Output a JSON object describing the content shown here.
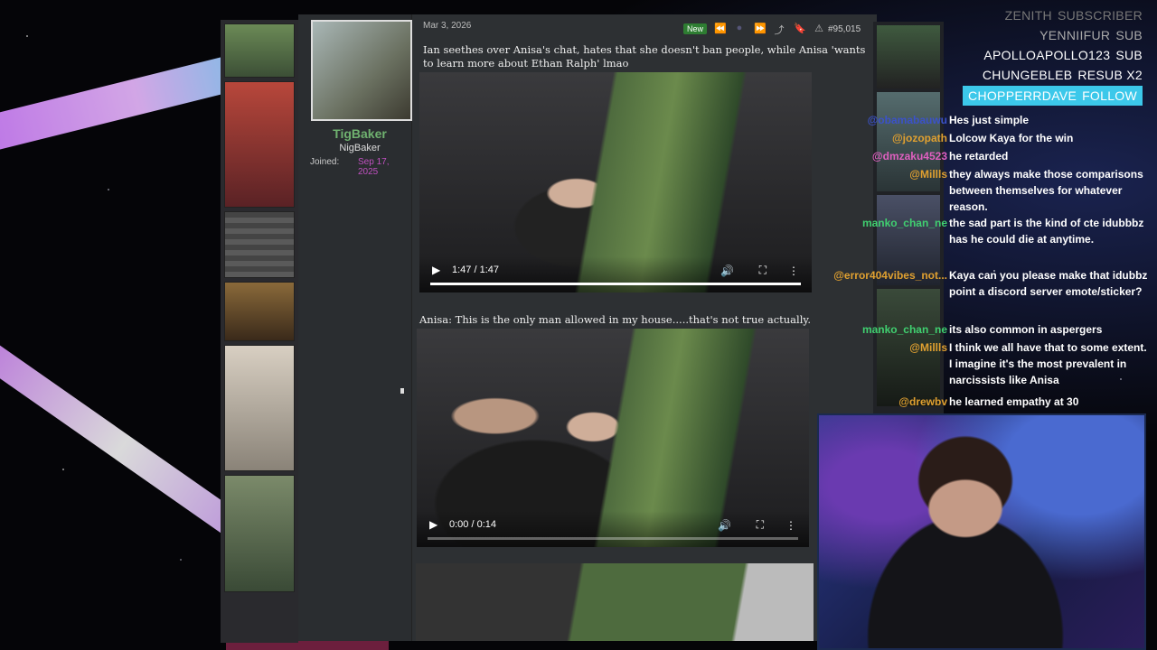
{
  "post": {
    "date": "Mar 3, 2026",
    "new_badge": "New",
    "number": "#95,015",
    "text": "Ian seethes over Anisa's chat, hates that she doesn't ban people, while Anisa 'wants to learn more about Ethan Ralph' lmao",
    "caption": "Anisa: This is the only man allowed in my house.....that's not true actually."
  },
  "user": {
    "name": "TigBaker",
    "title": "NigBaker",
    "joined_label": "Joined:",
    "joined_value": "Sep 17, 2025"
  },
  "videos": [
    {
      "time": "1:47 / 1:47",
      "progress": 1.0
    },
    {
      "time": "0:00 / 0:14",
      "progress": 0.0
    }
  ],
  "icons": {
    "play": "▶",
    "volume": "🔊",
    "fullscreen": "⛶",
    "more": "⋮",
    "rewind": "⏪",
    "forward": "⏩",
    "share": "⤴",
    "bookmark": "🔖",
    "report": "⚠"
  },
  "alerts": [
    {
      "name": "ZENITH",
      "type": "SUBSCRIBER"
    },
    {
      "name": "YENNIIFUR",
      "type": "SUB"
    },
    {
      "name": "APOLLOAPOLLO123",
      "type": "SUB"
    },
    {
      "name": "CHUNGEBLEB",
      "type": "RESUB X2"
    },
    {
      "name": "CHOPPERRDAVE",
      "type": "FOLLOW"
    }
  ],
  "chat": [
    {
      "user": "@obamabauwu",
      "color": "#3b52c9",
      "msg": "Hes just simple"
    },
    {
      "user": "@jozopath",
      "color": "#e0a030",
      "msg": "Lolcow Kaya for the win"
    },
    {
      "user": "@dmzaku4523",
      "color": "#e060c0",
      "msg": "he retarded"
    },
    {
      "user": "@Millls",
      "color": "#e0a030",
      "msg": "they always make those comparisons between themselves for whatever reason."
    },
    {
      "user": "manko_chan_ne",
      "color": "#40d070",
      "msg": "the sad part is the kind of cte idubbbz has he could die at anytime."
    },
    {
      "user": "@error404vibes_not...",
      "color": "#e0a030",
      "msg": "Kaya can you please make that idubbz point a discord server emote/sticker?"
    },
    {
      "user": "manko_chan_ne",
      "color": "#40d070",
      "msg": "its also common in aspergers"
    },
    {
      "user": "@Millls",
      "color": "#e0a030",
      "msg": "I think we all have that to some extent. I imagine it's the most prevalent in narcissists like Anisa"
    },
    {
      "user": "@drewbv",
      "color": "#e0a030",
      "msg": "he learned empathy at 30"
    }
  ]
}
